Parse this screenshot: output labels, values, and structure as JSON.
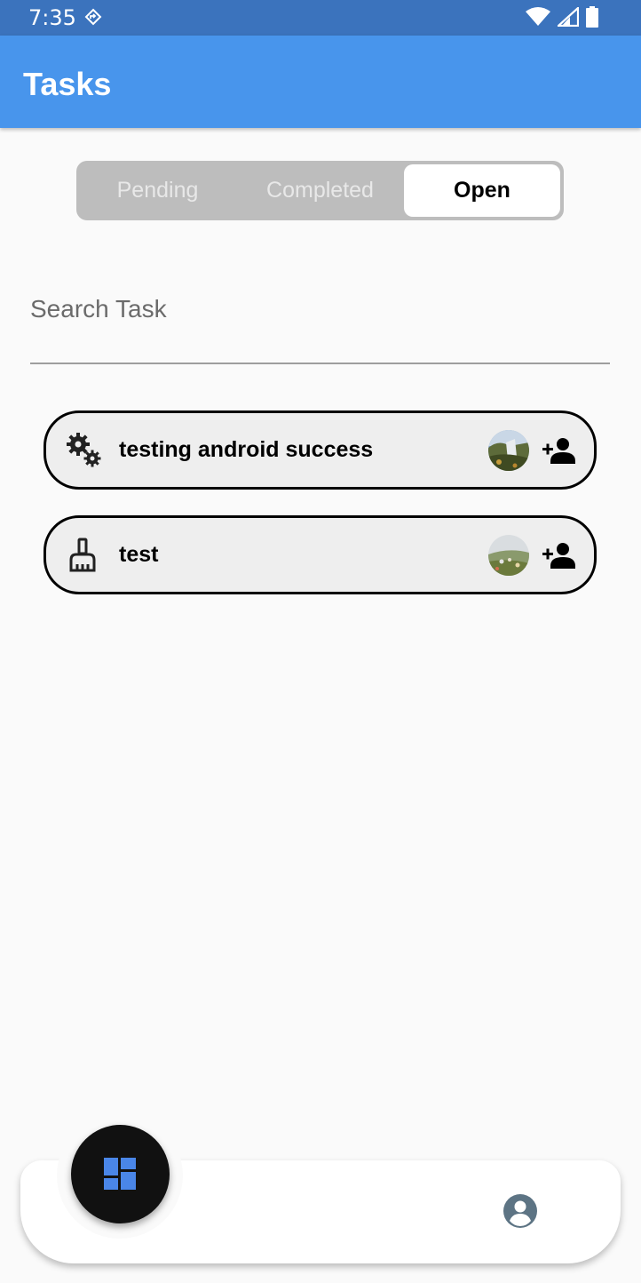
{
  "status_bar": {
    "time": "7:35"
  },
  "app_bar": {
    "title": "Tasks"
  },
  "tabs": [
    {
      "label": "Pending",
      "selected": false
    },
    {
      "label": "Completed",
      "selected": false
    },
    {
      "label": "Open",
      "selected": true
    }
  ],
  "search": {
    "placeholder": "Search Task",
    "value": ""
  },
  "tasks": [
    {
      "title": "testing android success",
      "icon": "gears-icon"
    },
    {
      "title": "test",
      "icon": "cleaning-brush-icon"
    }
  ],
  "bottom_nav": {
    "fab_icon": "dashboard-icon",
    "right_icon": "account-circle-icon"
  },
  "colors": {
    "app_bar": "#4895ec",
    "status_bar": "#3b73bd",
    "fab_icon": "#4a86e8"
  }
}
